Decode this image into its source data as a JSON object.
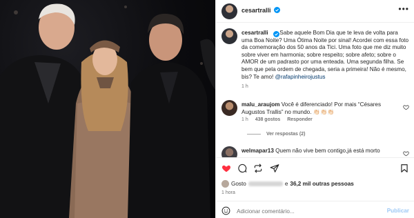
{
  "post": {
    "username": "cesartralli",
    "caption_text": "Sabe aquele Bom Dia que te leva de volta para uma Boa Noite? Uma Ótima Noite por sinal! Acordei com essa foto da comemoração dos 50 anos da Tici. Uma foto que me diz muito sobre viver em harmonia; sobre respeito; sobre afeto; sobre o AMOR de um padrasto por uma enteada. Uma segunda filha. Se bem que pela ordem de chegada, seria a primeira! Não é mesmo, bis? Te amo!",
    "caption_mention": "@rafapinheirojustus",
    "caption_time": "1 h",
    "more_icon": "•••"
  },
  "comments": [
    {
      "username": "malu_araujom",
      "text": "Você é diferenciado! Por mais “Césares Augustos Trallis” no mundo.",
      "emojis": "👏🏻👏🏻👏🏻",
      "time": "1 h",
      "likes": "438 gostos",
      "reply_label": "Responder",
      "view_replies": "Ver respostas (2)"
    },
    {
      "username": "welmapar13",
      "text": "Quem não vive bem contigo,já está morto",
      "tail": "..."
    }
  ],
  "actions": {
    "likes_prefix": "Gosto",
    "likes_suffix": "e",
    "likes_count": "36,2 mil outras pessoas",
    "post_time": "1 hora"
  },
  "comment_box": {
    "placeholder": "Adicionar comentário...",
    "publish_label": "Publicar"
  },
  "colors": {
    "verified": "#0095f6",
    "like_red": "#ff3040",
    "publish_disabled": "#9ec9f5"
  }
}
